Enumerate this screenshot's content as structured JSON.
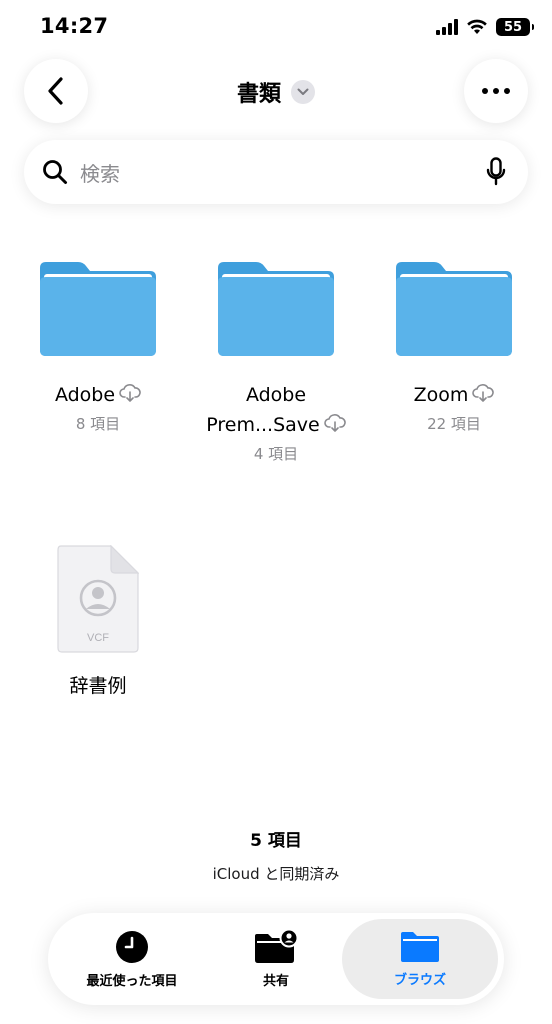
{
  "status_bar": {
    "time": "14:27",
    "battery": "55"
  },
  "nav": {
    "title": "書類"
  },
  "search": {
    "placeholder": "検索"
  },
  "items": [
    {
      "name": "Adobe",
      "count": "8 項目"
    },
    {
      "name_line1": "Adobe",
      "name_line2": "Prem...Save",
      "count": "4 項目"
    },
    {
      "name": "Zoom",
      "count": "22 項目"
    },
    {
      "name": "辞書例",
      "type_label": "VCF"
    }
  ],
  "summary": {
    "count": "5 項目",
    "sync": "iCloud と同期済み"
  },
  "tabbar": {
    "recent": "最近使った項目",
    "shared": "共有",
    "browse": "ブラウズ"
  },
  "colors": {
    "folder": "#5ab3ea",
    "accent": "#0a7aff"
  }
}
